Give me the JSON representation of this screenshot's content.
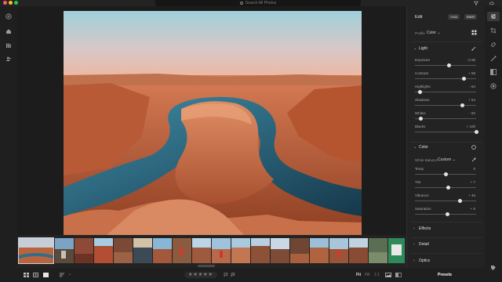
{
  "search": {
    "placeholder": "Search All Photos"
  },
  "edit_panel": {
    "title": "Edit",
    "auto_label": "Auto",
    "bw_label": "B&W",
    "profile_label": "Profile",
    "profile_value": "Color",
    "light": {
      "header": "Light",
      "sliders": [
        {
          "label": "Exposure",
          "value": "- 0.36",
          "level": 0.55
        },
        {
          "label": "Contrast",
          "value": "+ 58",
          "level": 0.79
        },
        {
          "label": "Highlights",
          "value": "- 84",
          "level": 0.08
        },
        {
          "label": "Shadows",
          "value": "+ 54",
          "level": 0.77
        },
        {
          "label": "Whites",
          "value": "- 82",
          "level": 0.09
        },
        {
          "label": "Blacks",
          "value": "+ 100",
          "level": 1.0
        }
      ]
    },
    "color": {
      "header": "Color",
      "white_balance_label": "White Balance",
      "white_balance_value": "Custom",
      "sliders": [
        {
          "label": "Temp",
          "value": "0",
          "level": 0.5
        },
        {
          "label": "Tint",
          "value": "+ 7",
          "level": 0.54
        },
        {
          "label": "Vibrance",
          "value": "+ 46",
          "level": 0.73
        },
        {
          "label": "Saturation",
          "value": "+ 6",
          "level": 0.53
        }
      ]
    },
    "sections": [
      "Effects",
      "Detail",
      "Optics"
    ],
    "presets_label": "Presets"
  },
  "bottombar": {
    "stars": "★★★★★",
    "fit_label": "Fit",
    "fill_label": "Fill",
    "ratio_label": "1:1"
  },
  "colors": {
    "panel_bg": "#232323",
    "accent": "#e4e4e4",
    "traffic_red": "#ff5f57",
    "traffic_yellow": "#febc2e",
    "traffic_green": "#28c840"
  }
}
